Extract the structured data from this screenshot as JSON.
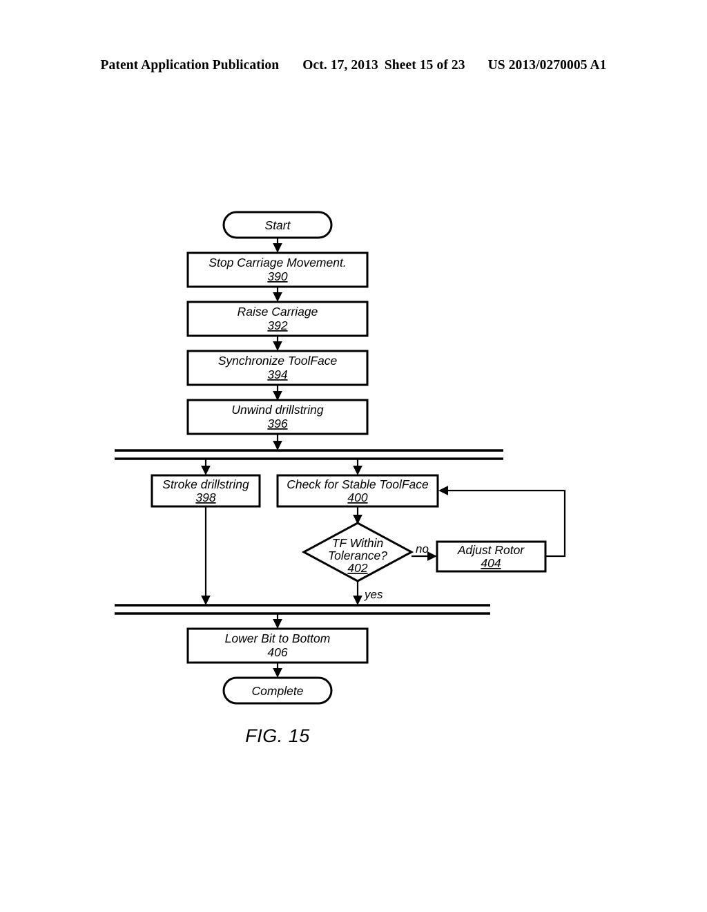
{
  "header": {
    "publication": "Patent Application Publication",
    "date": "Oct. 17, 2013",
    "sheet": "Sheet 15 of 23",
    "document_number": "US 2013/0270005 A1"
  },
  "figure": {
    "caption": "FIG. 15",
    "nodes": {
      "start": {
        "label": "Start",
        "ref": ""
      },
      "stop_carriage": {
        "label": "Stop Carriage Movement.",
        "ref": "390"
      },
      "raise_carriage": {
        "label": "Raise Carriage",
        "ref": "392"
      },
      "sync_toolface": {
        "label": "Synchronize ToolFace",
        "ref": "394"
      },
      "unwind_drillstring": {
        "label": "Unwind drillstring",
        "ref": "396"
      },
      "stroke_drillstring": {
        "label": "Stroke drillstring",
        "ref": "398"
      },
      "check_stable_toolface": {
        "label": "Check for Stable ToolFace",
        "ref": "400"
      },
      "tf_within_tolerance": {
        "label_line1": "TF Within",
        "label_line2": "Tolerance?",
        "ref": "402"
      },
      "adjust_rotor": {
        "label": "Adjust Rotor",
        "ref": "404"
      },
      "lower_bit": {
        "label": "Lower Bit to Bottom",
        "ref": "406"
      },
      "complete": {
        "label": "Complete",
        "ref": ""
      }
    },
    "edge_labels": {
      "decision_no": "no",
      "decision_yes": "yes"
    }
  }
}
